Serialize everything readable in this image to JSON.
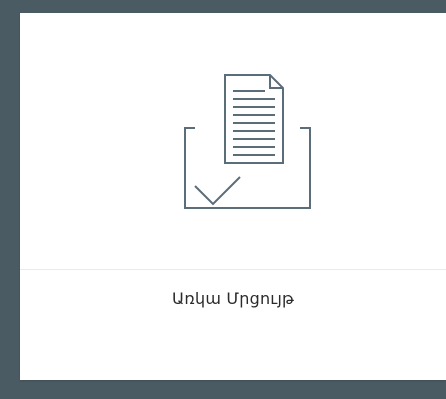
{
  "card": {
    "label": "Առկա Մրցույթ",
    "icon": "document-in-tray-check-icon"
  },
  "colors": {
    "background": "#4b5b63",
    "card": "#ffffff",
    "icon_stroke": "#5b6d78",
    "label": "#2b2b2b"
  }
}
